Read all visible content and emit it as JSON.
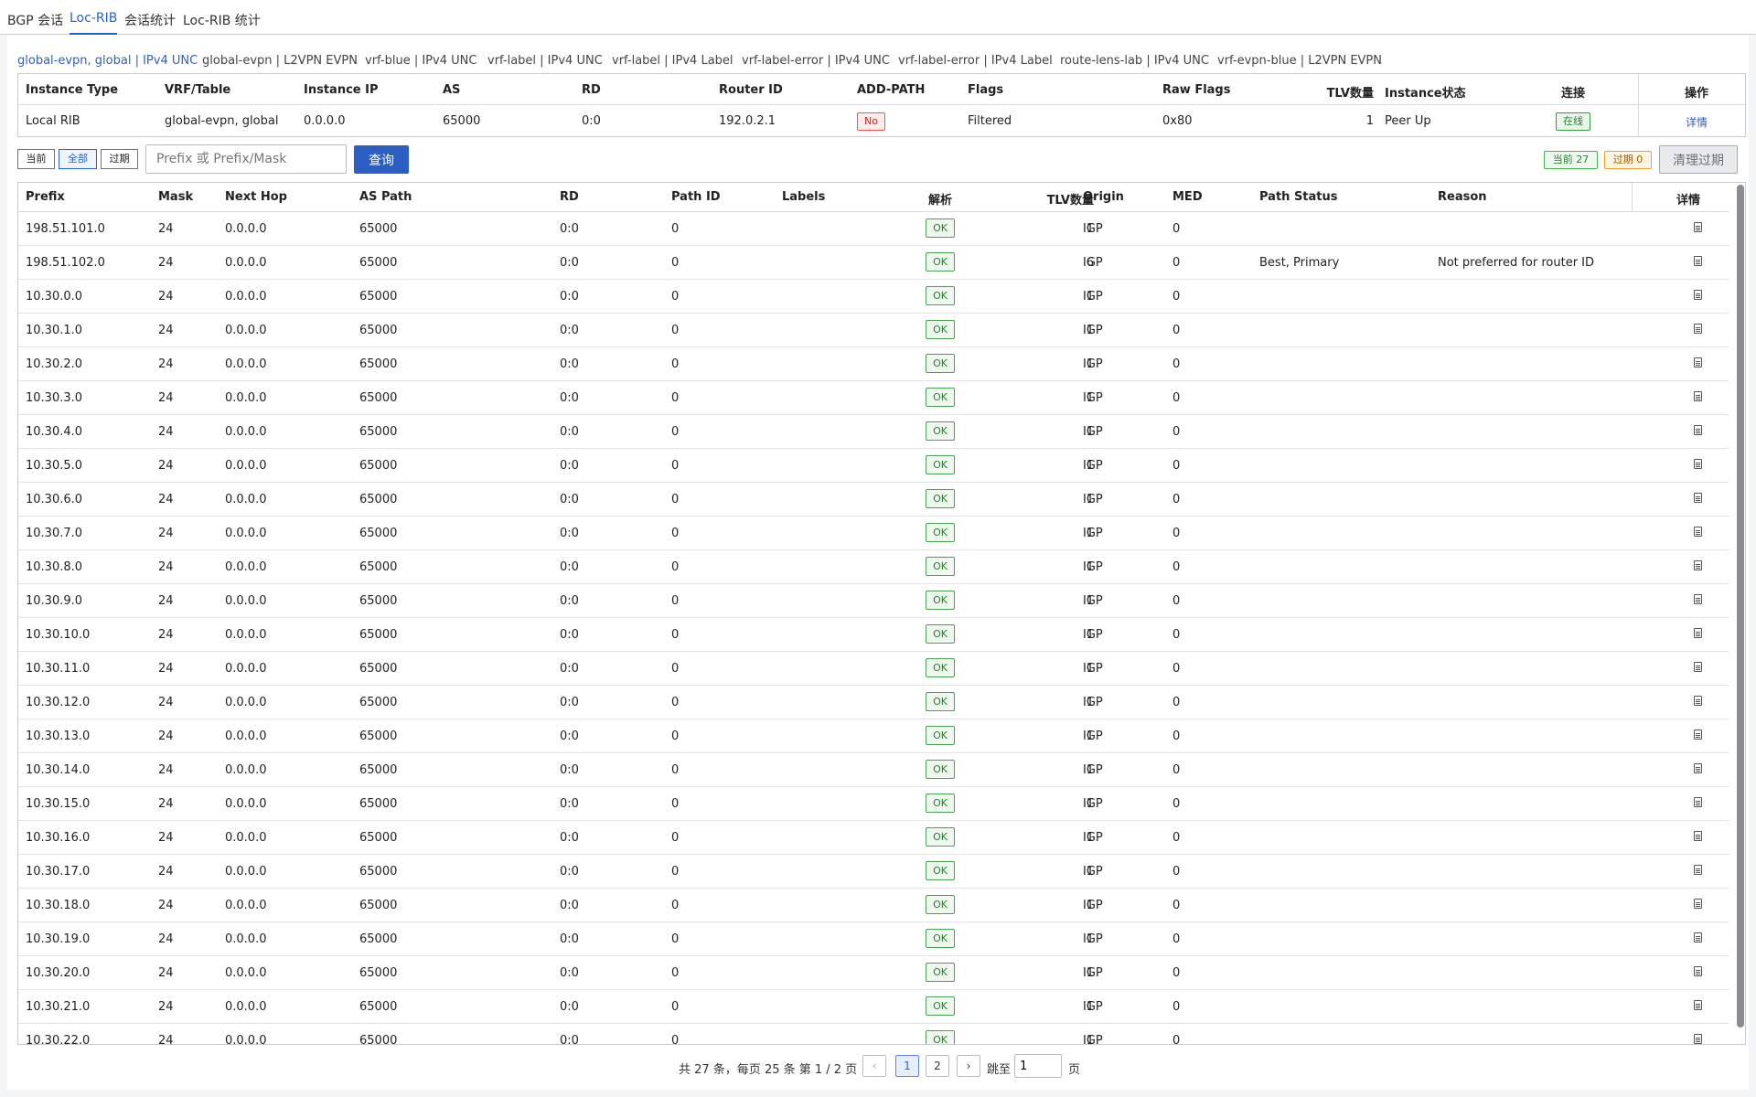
{
  "top_tabs": [
    "BGP 会话",
    "Loc-RIB",
    "会话统计",
    "Loc-RIB 统计"
  ],
  "active_top_tab": 1,
  "sub_tabs": [
    "global-evpn, global | IPv4 UNC",
    "global-evpn | L2VPN EVPN",
    "vrf-blue | IPv4 UNC",
    "vrf-label | IPv4 UNC",
    "vrf-label | IPv4 Label",
    "vrf-label-error | IPv4 UNC",
    "vrf-label-error | IPv4 Label",
    "route-lens-lab | IPv4 UNC",
    "vrf-evpn-blue | L2VPN EVPN"
  ],
  "instance": {
    "headers": {
      "instance_type": "Instance Type",
      "vrf_table": "VRF/Table",
      "instance_ip": "Instance IP",
      "as": "AS",
      "rd": "RD",
      "router_id": "Router ID",
      "add_path": "ADD-PATH",
      "flags": "Flags",
      "raw_flags": "Raw Flags",
      "tlv_count": "TLV数量",
      "instance_status": "Instance状态",
      "connection": "连接",
      "actions": "操作"
    },
    "row": {
      "instance_type": "Local RIB",
      "vrf_table": "global-evpn, global",
      "instance_ip": "0.0.0.0",
      "as": "65000",
      "rd": "0:0",
      "router_id": "192.0.2.1",
      "add_path": "No",
      "flags": "Filtered",
      "raw_flags": "0x80",
      "tlv_count": "1",
      "instance_status": "Peer Up",
      "connection": "在线",
      "action": "详情"
    }
  },
  "filters": {
    "current": "当前",
    "all": "全部",
    "expired": "过期",
    "search_placeholder": "Prefix 或 Prefix/Mask",
    "query": "查询",
    "current_count": "当前 27",
    "expired_count": "过期 0",
    "clean": "清理过期"
  },
  "table": {
    "headers": {
      "prefix": "Prefix",
      "mask": "Mask",
      "next_hop": "Next Hop",
      "as_path": "AS Path",
      "rd": "RD",
      "path_id": "Path ID",
      "labels": "Labels",
      "parse": "解析",
      "tlv_count": "TLV数量",
      "origin": "Origin",
      "med": "MED",
      "path_status": "Path Status",
      "reason": "Reason",
      "details": "详情"
    },
    "rows": [
      {
        "prefix": "198.51.101.0",
        "mask": "24",
        "next_hop": "0.0.0.0",
        "as_path": "65000",
        "rd": "0:0",
        "path_id": "0",
        "labels": "",
        "parse": "OK",
        "tlv": "1",
        "origin": "IGP",
        "med": "0",
        "path_status": "",
        "reason": ""
      },
      {
        "prefix": "198.51.102.0",
        "mask": "24",
        "next_hop": "0.0.0.0",
        "as_path": "65000",
        "rd": "0:0",
        "path_id": "0",
        "labels": "",
        "parse": "OK",
        "tlv": "6",
        "origin": "IGP",
        "med": "0",
        "path_status": "Best, Primary",
        "reason": "Not preferred for router ID"
      },
      {
        "prefix": "10.30.0.0",
        "mask": "24",
        "next_hop": "0.0.0.0",
        "as_path": "65000",
        "rd": "0:0",
        "path_id": "0",
        "labels": "",
        "parse": "OK",
        "tlv": "1",
        "origin": "IGP",
        "med": "0",
        "path_status": "",
        "reason": ""
      },
      {
        "prefix": "10.30.1.0",
        "mask": "24",
        "next_hop": "0.0.0.0",
        "as_path": "65000",
        "rd": "0:0",
        "path_id": "0",
        "labels": "",
        "parse": "OK",
        "tlv": "1",
        "origin": "IGP",
        "med": "0",
        "path_status": "",
        "reason": ""
      },
      {
        "prefix": "10.30.2.0",
        "mask": "24",
        "next_hop": "0.0.0.0",
        "as_path": "65000",
        "rd": "0:0",
        "path_id": "0",
        "labels": "",
        "parse": "OK",
        "tlv": "1",
        "origin": "IGP",
        "med": "0",
        "path_status": "",
        "reason": ""
      },
      {
        "prefix": "10.30.3.0",
        "mask": "24",
        "next_hop": "0.0.0.0",
        "as_path": "65000",
        "rd": "0:0",
        "path_id": "0",
        "labels": "",
        "parse": "OK",
        "tlv": "1",
        "origin": "IGP",
        "med": "0",
        "path_status": "",
        "reason": ""
      },
      {
        "prefix": "10.30.4.0",
        "mask": "24",
        "next_hop": "0.0.0.0",
        "as_path": "65000",
        "rd": "0:0",
        "path_id": "0",
        "labels": "",
        "parse": "OK",
        "tlv": "1",
        "origin": "IGP",
        "med": "0",
        "path_status": "",
        "reason": ""
      },
      {
        "prefix": "10.30.5.0",
        "mask": "24",
        "next_hop": "0.0.0.0",
        "as_path": "65000",
        "rd": "0:0",
        "path_id": "0",
        "labels": "",
        "parse": "OK",
        "tlv": "1",
        "origin": "IGP",
        "med": "0",
        "path_status": "",
        "reason": ""
      },
      {
        "prefix": "10.30.6.0",
        "mask": "24",
        "next_hop": "0.0.0.0",
        "as_path": "65000",
        "rd": "0:0",
        "path_id": "0",
        "labels": "",
        "parse": "OK",
        "tlv": "1",
        "origin": "IGP",
        "med": "0",
        "path_status": "",
        "reason": ""
      },
      {
        "prefix": "10.30.7.0",
        "mask": "24",
        "next_hop": "0.0.0.0",
        "as_path": "65000",
        "rd": "0:0",
        "path_id": "0",
        "labels": "",
        "parse": "OK",
        "tlv": "1",
        "origin": "IGP",
        "med": "0",
        "path_status": "",
        "reason": ""
      },
      {
        "prefix": "10.30.8.0",
        "mask": "24",
        "next_hop": "0.0.0.0",
        "as_path": "65000",
        "rd": "0:0",
        "path_id": "0",
        "labels": "",
        "parse": "OK",
        "tlv": "1",
        "origin": "IGP",
        "med": "0",
        "path_status": "",
        "reason": ""
      },
      {
        "prefix": "10.30.9.0",
        "mask": "24",
        "next_hop": "0.0.0.0",
        "as_path": "65000",
        "rd": "0:0",
        "path_id": "0",
        "labels": "",
        "parse": "OK",
        "tlv": "1",
        "origin": "IGP",
        "med": "0",
        "path_status": "",
        "reason": ""
      },
      {
        "prefix": "10.30.10.0",
        "mask": "24",
        "next_hop": "0.0.0.0",
        "as_path": "65000",
        "rd": "0:0",
        "path_id": "0",
        "labels": "",
        "parse": "OK",
        "tlv": "1",
        "origin": "IGP",
        "med": "0",
        "path_status": "",
        "reason": ""
      },
      {
        "prefix": "10.30.11.0",
        "mask": "24",
        "next_hop": "0.0.0.0",
        "as_path": "65000",
        "rd": "0:0",
        "path_id": "0",
        "labels": "",
        "parse": "OK",
        "tlv": "1",
        "origin": "IGP",
        "med": "0",
        "path_status": "",
        "reason": ""
      },
      {
        "prefix": "10.30.12.0",
        "mask": "24",
        "next_hop": "0.0.0.0",
        "as_path": "65000",
        "rd": "0:0",
        "path_id": "0",
        "labels": "",
        "parse": "OK",
        "tlv": "1",
        "origin": "IGP",
        "med": "0",
        "path_status": "",
        "reason": ""
      },
      {
        "prefix": "10.30.13.0",
        "mask": "24",
        "next_hop": "0.0.0.0",
        "as_path": "65000",
        "rd": "0:0",
        "path_id": "0",
        "labels": "",
        "parse": "OK",
        "tlv": "1",
        "origin": "IGP",
        "med": "0",
        "path_status": "",
        "reason": ""
      },
      {
        "prefix": "10.30.14.0",
        "mask": "24",
        "next_hop": "0.0.0.0",
        "as_path": "65000",
        "rd": "0:0",
        "path_id": "0",
        "labels": "",
        "parse": "OK",
        "tlv": "1",
        "origin": "IGP",
        "med": "0",
        "path_status": "",
        "reason": ""
      },
      {
        "prefix": "10.30.15.0",
        "mask": "24",
        "next_hop": "0.0.0.0",
        "as_path": "65000",
        "rd": "0:0",
        "path_id": "0",
        "labels": "",
        "parse": "OK",
        "tlv": "1",
        "origin": "IGP",
        "med": "0",
        "path_status": "",
        "reason": ""
      },
      {
        "prefix": "10.30.16.0",
        "mask": "24",
        "next_hop": "0.0.0.0",
        "as_path": "65000",
        "rd": "0:0",
        "path_id": "0",
        "labels": "",
        "parse": "OK",
        "tlv": "1",
        "origin": "IGP",
        "med": "0",
        "path_status": "",
        "reason": ""
      },
      {
        "prefix": "10.30.17.0",
        "mask": "24",
        "next_hop": "0.0.0.0",
        "as_path": "65000",
        "rd": "0:0",
        "path_id": "0",
        "labels": "",
        "parse": "OK",
        "tlv": "1",
        "origin": "IGP",
        "med": "0",
        "path_status": "",
        "reason": ""
      },
      {
        "prefix": "10.30.18.0",
        "mask": "24",
        "next_hop": "0.0.0.0",
        "as_path": "65000",
        "rd": "0:0",
        "path_id": "0",
        "labels": "",
        "parse": "OK",
        "tlv": "1",
        "origin": "IGP",
        "med": "0",
        "path_status": "",
        "reason": ""
      },
      {
        "prefix": "10.30.19.0",
        "mask": "24",
        "next_hop": "0.0.0.0",
        "as_path": "65000",
        "rd": "0:0",
        "path_id": "0",
        "labels": "",
        "parse": "OK",
        "tlv": "1",
        "origin": "IGP",
        "med": "0",
        "path_status": "",
        "reason": ""
      },
      {
        "prefix": "10.30.20.0",
        "mask": "24",
        "next_hop": "0.0.0.0",
        "as_path": "65000",
        "rd": "0:0",
        "path_id": "0",
        "labels": "",
        "parse": "OK",
        "tlv": "1",
        "origin": "IGP",
        "med": "0",
        "path_status": "",
        "reason": ""
      },
      {
        "prefix": "10.30.21.0",
        "mask": "24",
        "next_hop": "0.0.0.0",
        "as_path": "65000",
        "rd": "0:0",
        "path_id": "0",
        "labels": "",
        "parse": "OK",
        "tlv": "1",
        "origin": "IGP",
        "med": "0",
        "path_status": "",
        "reason": ""
      },
      {
        "prefix": "10.30.22.0",
        "mask": "24",
        "next_hop": "0.0.0.0",
        "as_path": "65000",
        "rd": "0:0",
        "path_id": "0",
        "labels": "",
        "parse": "OK",
        "tlv": "1",
        "origin": "IGP",
        "med": "0",
        "path_status": "",
        "reason": ""
      }
    ]
  },
  "pagination": {
    "summary": "共 27 条，每页 25 条   第 1 / 2 页",
    "prev": "‹",
    "pages": [
      "1",
      "2"
    ],
    "current_page": "1",
    "next": "›",
    "jump_label": "跳至",
    "jump_value": "1",
    "page_suffix": "页"
  }
}
